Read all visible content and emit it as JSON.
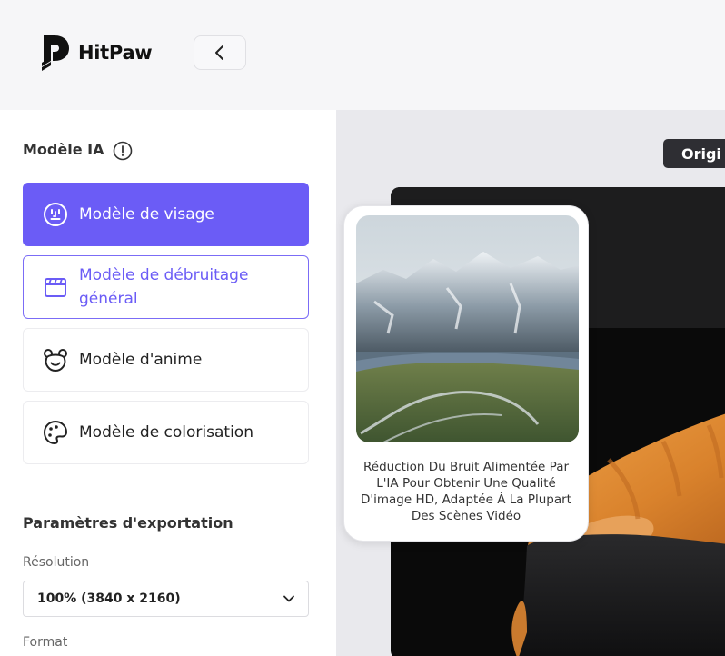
{
  "header": {
    "brand": "HitPaw",
    "back_icon": "chevron-left-icon"
  },
  "sidebar": {
    "ai_model_title": "Modèle IA",
    "models": [
      {
        "label": "Modèle de visage",
        "icon": "face-icon",
        "state": "selected"
      },
      {
        "label": "Modèle de débruitage général",
        "icon": "film-clapper-icon",
        "state": "hover"
      },
      {
        "label": "Modèle d'anime",
        "icon": "bear-face-icon",
        "state": "default"
      },
      {
        "label": "Modèle de colorisation",
        "icon": "palette-icon",
        "state": "default"
      }
    ],
    "export_title": "Paramètres d'exportation",
    "resolution_label": "Résolution",
    "resolution_value": "100% (3840 x 2160)",
    "format_label": "Format"
  },
  "preview": {
    "badge": "Origi",
    "tooltip_text": "Réduction Du Bruit Alimentée Par L'IA Pour Obtenir Une Qualité D'image HD, Adaptée À La Plupart Des Scènes Vidéo"
  },
  "colors": {
    "accent": "#6b5cf6",
    "sidebar_bg": "#ffffff",
    "preview_bg": "#e9e9ed",
    "badge_bg": "#2e2e33"
  }
}
